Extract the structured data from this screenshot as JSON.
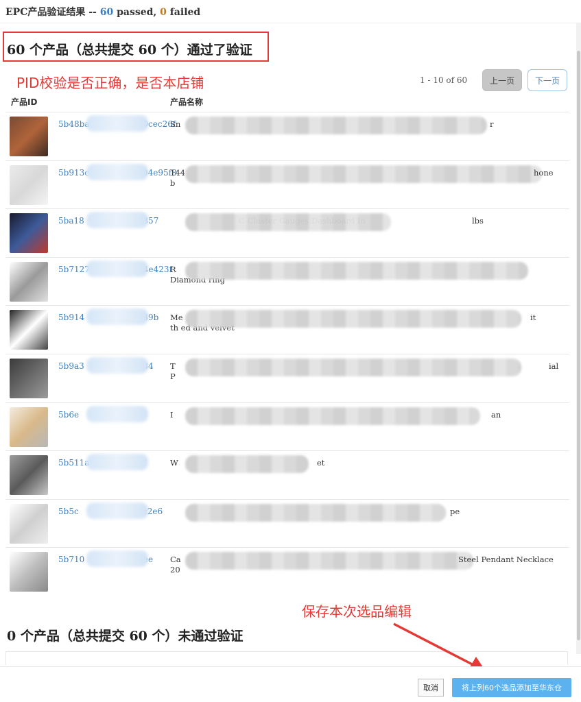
{
  "header": {
    "title": "EPC产品验证结果",
    "sep": "--",
    "passed_count": "60",
    "passed_label": "passed,",
    "failed_count": "0",
    "failed_label": "failed"
  },
  "pass_section": {
    "title": "60 个产品（总共提交 60 个）通过了验证"
  },
  "annotations": {
    "pid_check": "PID校验是否正确，是否本店铺",
    "save_edit": "保存本次选品编辑"
  },
  "pagination": {
    "info": "1 - 10 of 60",
    "prev": "上一页",
    "next": "下一页"
  },
  "columns": {
    "id": "产品ID",
    "name": "产品名称"
  },
  "rows": [
    {
      "pid_start": "5b48ba",
      "pid_end": "0cec26f",
      "name_head": "Sn",
      "name_tail": "r",
      "thumb_colors": [
        "#7a4a35",
        "#b0643a",
        "#3d2b22"
      ]
    },
    {
      "pid_start": "5b913c",
      "pid_end": "04e95f8",
      "name_head": "144",
      "name_line2": "b",
      "name_tail": "hone",
      "thumb_colors": [
        "#ebebeb",
        "#d8d8d8",
        "#f4f4f4"
      ]
    },
    {
      "pid_start": "5ba18",
      "pid_end": "7857",
      "name_head": "",
      "name_mid": "C   Cluster Gauges Dashboard In",
      "name_tail": "lbs",
      "thumb_colors": [
        "#1a1a2e",
        "#3d5a99",
        "#c0392b"
      ]
    },
    {
      "pid_start": "5b7127",
      "pid_end": "4e423f",
      "name_head": "R",
      "name_line2": "Diamond ring",
      "name_tail": "",
      "thumb_colors": [
        "#ffffff",
        "#9a9a9a",
        "#e0e0e0"
      ]
    },
    {
      "pid_start": "5b914",
      "pid_end": "e39b",
      "name_head": "Me",
      "name_line2": "th     ed and velvet",
      "name_tail": "it",
      "thumb_colors": [
        "#222222",
        "#ffffff",
        "#444444"
      ]
    },
    {
      "pid_start": "5b9a3",
      "pid_end": "084",
      "name_head": "T",
      "name_line2": "P",
      "name_tail": "ial",
      "thumb_colors": [
        "#3a3a3a",
        "#6b6b6b",
        "#9a9a9a"
      ]
    },
    {
      "pid_start": "5b6e",
      "pid_end": "88",
      "name_head": "I",
      "name_tail": "an",
      "thumb_colors": [
        "#f4ece0",
        "#d9b98a",
        "#b8b8b8"
      ]
    },
    {
      "pid_start": "5b511a",
      "pid_end": "f",
      "name_head": "W",
      "name_tail": "et",
      "thumb_colors": [
        "#9c9c9c",
        "#5a5a5a",
        "#c8c8c8"
      ]
    },
    {
      "pid_start": "5b5c",
      "pid_end": "0bc2e6",
      "name_head": "",
      "name_tail": "pe",
      "thumb_colors": [
        "#ffffff",
        "#cfcfcf",
        "#eeeeee"
      ]
    },
    {
      "pid_start": "5b710",
      "pid_end": "3ee",
      "name_head": "Ca",
      "name_line2": "20",
      "name_tail": "Steel Pendant Necklace",
      "thumb_colors": [
        "#ffffff",
        "#bdbdbd",
        "#8a8a8a"
      ]
    }
  ],
  "fail_section": {
    "title": "0 个产品（总共提交 60 个）未通过验证"
  },
  "footer": {
    "cancel": "取消",
    "save": "将上列60个选品添加至华东仓"
  },
  "colors": {
    "accent": "#5cb1ef",
    "annotation": "#e53935",
    "link": "#3f7fbf"
  }
}
